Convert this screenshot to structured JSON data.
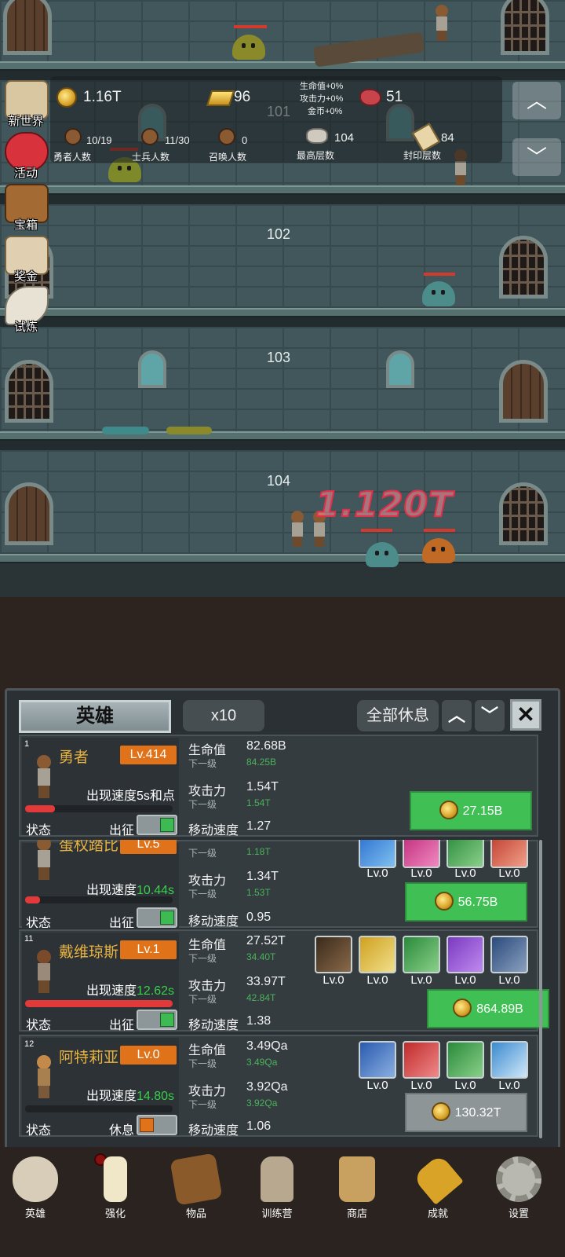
{
  "hud": {
    "gold": "1.16T",
    "gold_bars": "96",
    "buffs": [
      "生命值+0%",
      "攻击力+0%",
      "金币+0%"
    ],
    "meat": "51",
    "hero_count": "10/19",
    "hero_count_label": "勇者人数",
    "soldier_count": "11/30",
    "soldier_count_label": "士兵人数",
    "summon_count": "0",
    "summon_count_label": "召唤人数",
    "max_floor": "104",
    "max_floor_label": "最高层数",
    "sealed_floor": "84",
    "sealed_floor_label": "封印层数"
  },
  "floors": [
    "101",
    "102",
    "103",
    "104"
  ],
  "damage_text": "1.120T",
  "side_menu": [
    "新世界",
    "活动",
    "宝箱",
    "奖金",
    "试炼"
  ],
  "panel": {
    "title": "英雄",
    "multiplier": "x10",
    "rest_all": "全部休息",
    "labels": {
      "hp": "生命值",
      "next": "下一级",
      "atk": "攻击力",
      "move": "移动速度",
      "spawn": "出现速度",
      "state": "状态",
      "deploy": "出征",
      "rest": "休息"
    },
    "heroes": [
      {
        "index": "1",
        "name": "勇者",
        "level": "Lv.414",
        "spawn_speed": "5s和点",
        "hp": "82.68B",
        "hp_next": "84.25B",
        "atk": "1.54T",
        "atk_next": "1.54T",
        "move": "1.27",
        "cost": "27.15B",
        "state": "deploy",
        "hp_bar": 0.2
      },
      {
        "index": "",
        "name": "蛋权踏比",
        "level": "Lv.5",
        "spawn_speed": "10.44s",
        "hp": "",
        "hp_next": "1.18T",
        "atk": "1.34T",
        "atk_next": "1.53T",
        "move": "0.95",
        "cost": "56.75B",
        "state": "deploy",
        "hp_bar": 0.1,
        "skill_levels": [
          "Lv.0",
          "Lv.0",
          "Lv.0",
          "Lv.0"
        ]
      },
      {
        "index": "11",
        "name": "戴维琼斯",
        "level": "Lv.1",
        "spawn_speed": "12.62s",
        "hp": "27.52T",
        "hp_next": "34.40T",
        "atk": "33.97T",
        "atk_next": "42.84T",
        "move": "1.38",
        "cost": "864.89B",
        "state": "deploy",
        "hp_bar": 1.0,
        "skill_levels": [
          "Lv.0",
          "Lv.0",
          "Lv.0",
          "Lv.0",
          "Lv.0"
        ]
      },
      {
        "index": "12",
        "name": "阿特莉亚",
        "level": "Lv.0",
        "spawn_speed": "14.80s",
        "hp": "3.49Qa",
        "hp_next": "3.49Qa",
        "atk": "3.92Qa",
        "atk_next": "3.92Qa",
        "move": "1.06",
        "cost": "130.32T",
        "state": "rest",
        "hp_bar": 0,
        "skill_levels": [
          "Lv.0",
          "Lv.0",
          "Lv.0",
          "Lv.0"
        ]
      }
    ]
  },
  "nav": [
    "英雄",
    "强化",
    "物品",
    "训练营",
    "商店",
    "成就",
    "设置"
  ],
  "colors": {
    "accent_orange": "#e0721a",
    "buy_green": "#3fbf54",
    "name_gold": "#e8b340",
    "speed_green": "#39d04b"
  }
}
